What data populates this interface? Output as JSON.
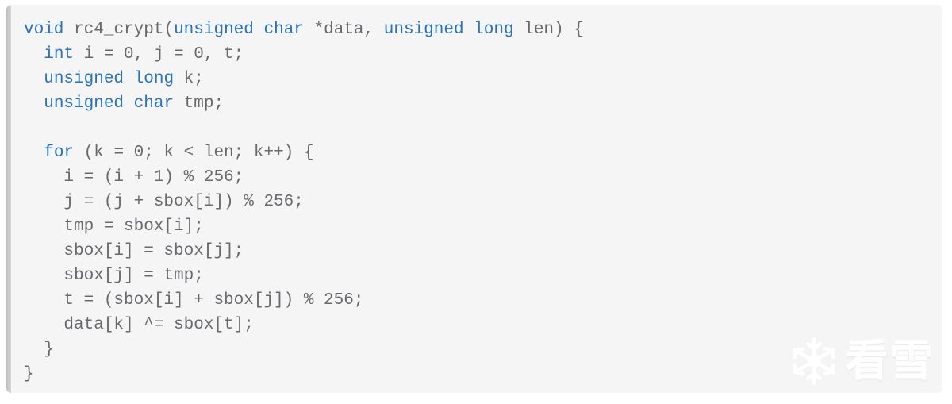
{
  "panel": {
    "background_color": "#f5f5f5",
    "accent_bar_color": "#c9c9c9",
    "page_background_color": "#ffffff"
  },
  "syntax": {
    "keyword_color": "#2b72b8",
    "default_color": "#69696d"
  },
  "code": {
    "language": "c",
    "full_text": "void rc4_crypt(unsigned char *data, unsigned long len) {\n  int i = 0, j = 0, t;\n  unsigned long k;\n  unsigned char tmp;\n\n  for (k = 0; k < len; k++) {\n    i = (i + 1) % 256;\n    j = (j + sbox[i]) % 256;\n    tmp = sbox[i];\n    sbox[i] = sbox[j];\n    sbox[j] = tmp;\n    t = (sbox[i] + sbox[j]) % 256;\n    data[k] ^= sbox[t];\n  }\n}",
    "lines": [
      {
        "n": 1,
        "text": "void rc4_crypt(unsigned char *data, unsigned long len) {",
        "tokens": [
          {
            "t": "void",
            "c": "kw"
          },
          {
            "t": " ",
            "c": "punc"
          },
          {
            "t": "rc4_crypt",
            "c": "fn"
          },
          {
            "t": "(",
            "c": "punc"
          },
          {
            "t": "unsigned",
            "c": "kw"
          },
          {
            "t": " ",
            "c": "punc"
          },
          {
            "t": "char",
            "c": "kw"
          },
          {
            "t": " *data, ",
            "c": "id"
          },
          {
            "t": "unsigned",
            "c": "kw"
          },
          {
            "t": " ",
            "c": "punc"
          },
          {
            "t": "long",
            "c": "kw"
          },
          {
            "t": " len) {",
            "c": "id"
          }
        ]
      },
      {
        "n": 2,
        "text": "  int i = 0, j = 0, t;",
        "tokens": [
          {
            "t": "  ",
            "c": "punc"
          },
          {
            "t": "int",
            "c": "kw"
          },
          {
            "t": " i = 0, j = 0, t;",
            "c": "id"
          }
        ]
      },
      {
        "n": 3,
        "text": "  unsigned long k;",
        "tokens": [
          {
            "t": "  ",
            "c": "punc"
          },
          {
            "t": "unsigned",
            "c": "kw"
          },
          {
            "t": " ",
            "c": "punc"
          },
          {
            "t": "long",
            "c": "kw"
          },
          {
            "t": " k;",
            "c": "id"
          }
        ]
      },
      {
        "n": 4,
        "text": "  unsigned char tmp;",
        "tokens": [
          {
            "t": "  ",
            "c": "punc"
          },
          {
            "t": "unsigned",
            "c": "kw"
          },
          {
            "t": " ",
            "c": "punc"
          },
          {
            "t": "char",
            "c": "kw"
          },
          {
            "t": " tmp;",
            "c": "id"
          }
        ]
      },
      {
        "n": 5,
        "text": "",
        "tokens": []
      },
      {
        "n": 6,
        "text": "  for (k = 0; k < len; k++) {",
        "tokens": [
          {
            "t": "  ",
            "c": "punc"
          },
          {
            "t": "for",
            "c": "kw"
          },
          {
            "t": " (k = 0; k < len; k++) {",
            "c": "id"
          }
        ]
      },
      {
        "n": 7,
        "text": "    i = (i + 1) % 256;",
        "tokens": [
          {
            "t": "    i = (i + 1) % 256;",
            "c": "id"
          }
        ]
      },
      {
        "n": 8,
        "text": "    j = (j + sbox[i]) % 256;",
        "tokens": [
          {
            "t": "    j = (j + sbox[i]) % 256;",
            "c": "id"
          }
        ]
      },
      {
        "n": 9,
        "text": "    tmp = sbox[i];",
        "tokens": [
          {
            "t": "    tmp = sbox[i];",
            "c": "id"
          }
        ]
      },
      {
        "n": 10,
        "text": "    sbox[i] = sbox[j];",
        "tokens": [
          {
            "t": "    sbox[i] = sbox[j];",
            "c": "id"
          }
        ]
      },
      {
        "n": 11,
        "text": "    sbox[j] = tmp;",
        "tokens": [
          {
            "t": "    sbox[j] = tmp;",
            "c": "id"
          }
        ]
      },
      {
        "n": 12,
        "text": "    t = (sbox[i] + sbox[j]) % 256;",
        "tokens": [
          {
            "t": "    t = (sbox[i] + sbox[j]) % 256;",
            "c": "id"
          }
        ]
      },
      {
        "n": 13,
        "text": "    data[k] ^= sbox[t];",
        "tokens": [
          {
            "t": "    data[k] ^= sbox[t];",
            "c": "id"
          }
        ]
      },
      {
        "n": 14,
        "text": "  }",
        "tokens": [
          {
            "t": "  }",
            "c": "punc"
          }
        ]
      },
      {
        "n": 15,
        "text": "}",
        "tokens": [
          {
            "t": "}",
            "c": "punc"
          }
        ]
      }
    ]
  },
  "watermark": {
    "icon": "snowflake-icon",
    "text": "看雪",
    "color": "#ffffff"
  }
}
